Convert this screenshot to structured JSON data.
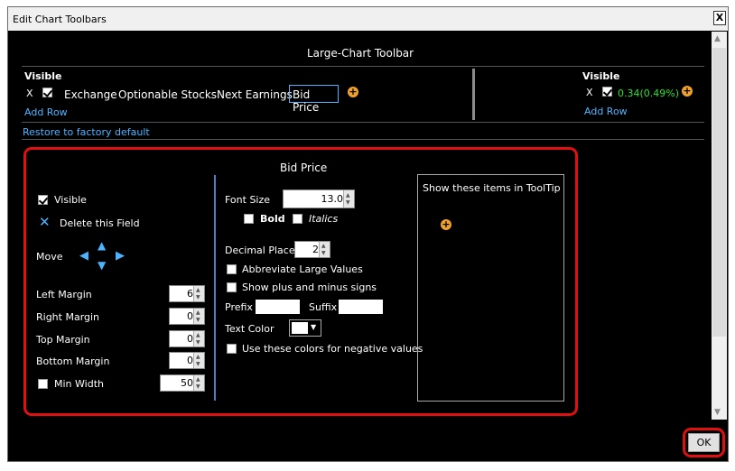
{
  "window": {
    "title": "Edit Chart Toolbars",
    "close_label": "X",
    "ok_label": "OK"
  },
  "toolbar_header": "Large-Chart Toolbar",
  "left_row": {
    "visible_label": "Visible",
    "x_label": "X",
    "items": [
      "Exchange",
      "Optionable Stocks",
      "Next Earnings",
      "Bid Price"
    ],
    "add_row": "Add Row"
  },
  "right_row": {
    "visible_label": "Visible",
    "x_label": "X",
    "value": "0.34(0.49%)",
    "add_row": "Add Row"
  },
  "restore": "Restore to factory default",
  "field": {
    "title": "Bid Price",
    "visible": "Visible",
    "delete": "Delete this Field",
    "move": "Move",
    "left_margin": {
      "label": "Left Margin",
      "value": "6"
    },
    "right_margin": {
      "label": "Right Margin",
      "value": "0"
    },
    "top_margin": {
      "label": "Top Margin",
      "value": "0"
    },
    "bottom_margin": {
      "label": "Bottom Margin",
      "value": "0"
    },
    "min_width": {
      "label": "Min Width",
      "value": "50"
    },
    "font_size": {
      "label": "Font Size",
      "value": "13.0"
    },
    "bold": "Bold",
    "italics": "Italics",
    "decimal_places": {
      "label": "Decimal Places",
      "value": "2"
    },
    "abbreviate": "Abbreviate Large Values",
    "plus_minus": "Show plus and minus signs",
    "prefix": "Prefix",
    "suffix": "Suffix",
    "text_color": "Text Color",
    "negative_colors": "Use these colors for negative values",
    "tooltip_title": "Show these items in ToolTip"
  },
  "colors": {
    "highlight": "#e01010",
    "link": "#4cb4ff",
    "positive": "#27e427",
    "accent": "#f0a22e"
  }
}
